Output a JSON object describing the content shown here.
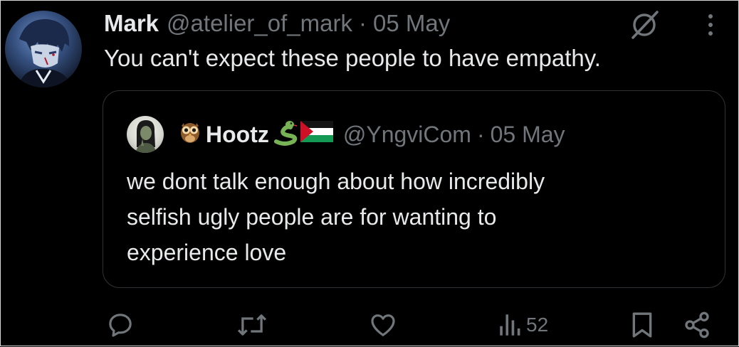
{
  "tweet": {
    "author_name": "Mark",
    "author_handle": "@atelier_of_mark",
    "separator": "·",
    "date": "05 May",
    "text": "You can't expect these people to have empathy."
  },
  "quoted": {
    "author_name": "Hootz",
    "author_handle": "@YngviCom",
    "separator": "·",
    "date": "05 May",
    "text_lines": [
      "we dont talk enough about how incredibly",
      "selfish ugly people are for wanting to",
      "experience love"
    ]
  },
  "actions": {
    "views_count": "52"
  },
  "colors": {
    "background": "#000000",
    "primary_text": "#e7e9ea",
    "secondary_text": "#71767b",
    "border": "#2f3336"
  },
  "icons": [
    "grok-icon",
    "more-icon",
    "reply-icon",
    "retweet-icon",
    "like-icon",
    "views-icon",
    "bookmark-icon",
    "share-icon",
    "owl-emoji",
    "snake-emoji",
    "palestine-flag-emoji"
  ]
}
